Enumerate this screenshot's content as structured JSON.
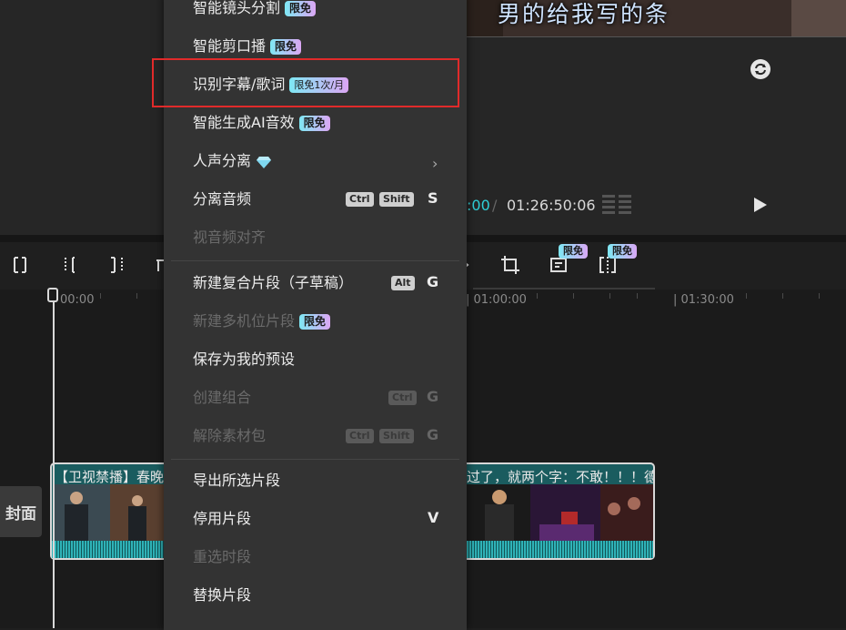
{
  "player": {
    "subtitle": "男的给我写的条",
    "time_current": ":00",
    "time_separator": "/",
    "time_total": "01:26:50:06"
  },
  "toolbar": {
    "badges": [
      "限免",
      "限免"
    ]
  },
  "ruler": {
    "labels": [
      "00:00",
      "| 01:00:00",
      "| 01:30:00"
    ]
  },
  "timeline": {
    "cover_label": "封面",
    "clip_title_left": "【卫视禁播】春晚",
    "clip_title_right": "过了，就两个字：不敢！！！德云"
  },
  "menu": {
    "items": [
      {
        "label": "智能镜头分割",
        "badge": "限免",
        "disabled": false
      },
      {
        "label": "智能剪口播",
        "badge": "限免",
        "disabled": false
      },
      {
        "label": "识别字幕/歌词",
        "badge": "限免1次/月",
        "disabled": false
      },
      {
        "label": "智能生成AI音效",
        "badge": "限免",
        "disabled": false
      },
      {
        "label": "人声分离",
        "disabled": false
      },
      {
        "label": "分离音频",
        "keys": [
          "Ctrl",
          "Shift"
        ],
        "letter": "S",
        "disabled": false
      },
      {
        "label": "视音频对齐",
        "disabled": true
      },
      {
        "label": "新建复合片段（子草稿）",
        "keys": [
          "Alt"
        ],
        "letter": "G",
        "disabled": false
      },
      {
        "label": "新建多机位片段",
        "badge": "限免",
        "disabled": true
      },
      {
        "label": "保存为我的预设",
        "disabled": false
      },
      {
        "label": "创建组合",
        "keys": [
          "Ctrl"
        ],
        "letter": "G",
        "disabled": true
      },
      {
        "label": "解除素材包",
        "keys": [
          "Ctrl",
          "Shift"
        ],
        "letter": "G",
        "disabled": true
      },
      {
        "label": "导出所选片段",
        "disabled": false
      },
      {
        "label": "停用片段",
        "letter": "V",
        "disabled": false
      },
      {
        "label": "重选时段",
        "disabled": true
      },
      {
        "label": "替换片段",
        "disabled": false
      }
    ]
  },
  "colors": {
    "accent": "#2fd0d8",
    "highlight_border": "#e12a2a",
    "menu_bg": "#333333"
  }
}
